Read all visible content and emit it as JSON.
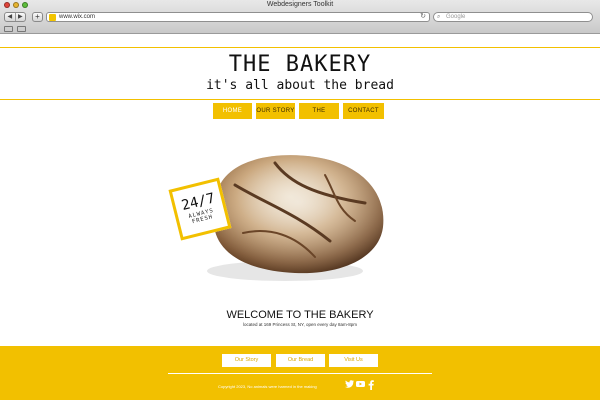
{
  "browser": {
    "window_title": "Webdesigners Toolkit",
    "back_icon": "back-arrow-icon",
    "forward_icon": "forward-arrow-icon",
    "url": "www.wix.com",
    "search_placeholder": "Google"
  },
  "site": {
    "title": "THE BAKERY",
    "tagline": "it's all about the bread",
    "accent_color": "#f2c000",
    "nav": [
      {
        "label": "HOME",
        "active": true
      },
      {
        "label": "OUR STORY",
        "active": false
      },
      {
        "label": "THE BREADS",
        "active": false
      },
      {
        "label": "CONTACT US",
        "active": false
      }
    ],
    "badge": {
      "main": "24/7",
      "sub": "ALWAYS FRESH"
    },
    "welcome": {
      "title": "WELCOME TO THE BAKERY",
      "subtitle": "located at 169 Princess St, NY, open every day 8am-8pm"
    },
    "footer": {
      "buttons": [
        {
          "label": "Our Story"
        },
        {
          "label": "Our Bread"
        },
        {
          "label": "Visit Us"
        }
      ],
      "copyright": "Copyright 2023, No animals were harmed in the making",
      "social": [
        "twitter-icon",
        "youtube-icon",
        "facebook-icon"
      ]
    }
  }
}
